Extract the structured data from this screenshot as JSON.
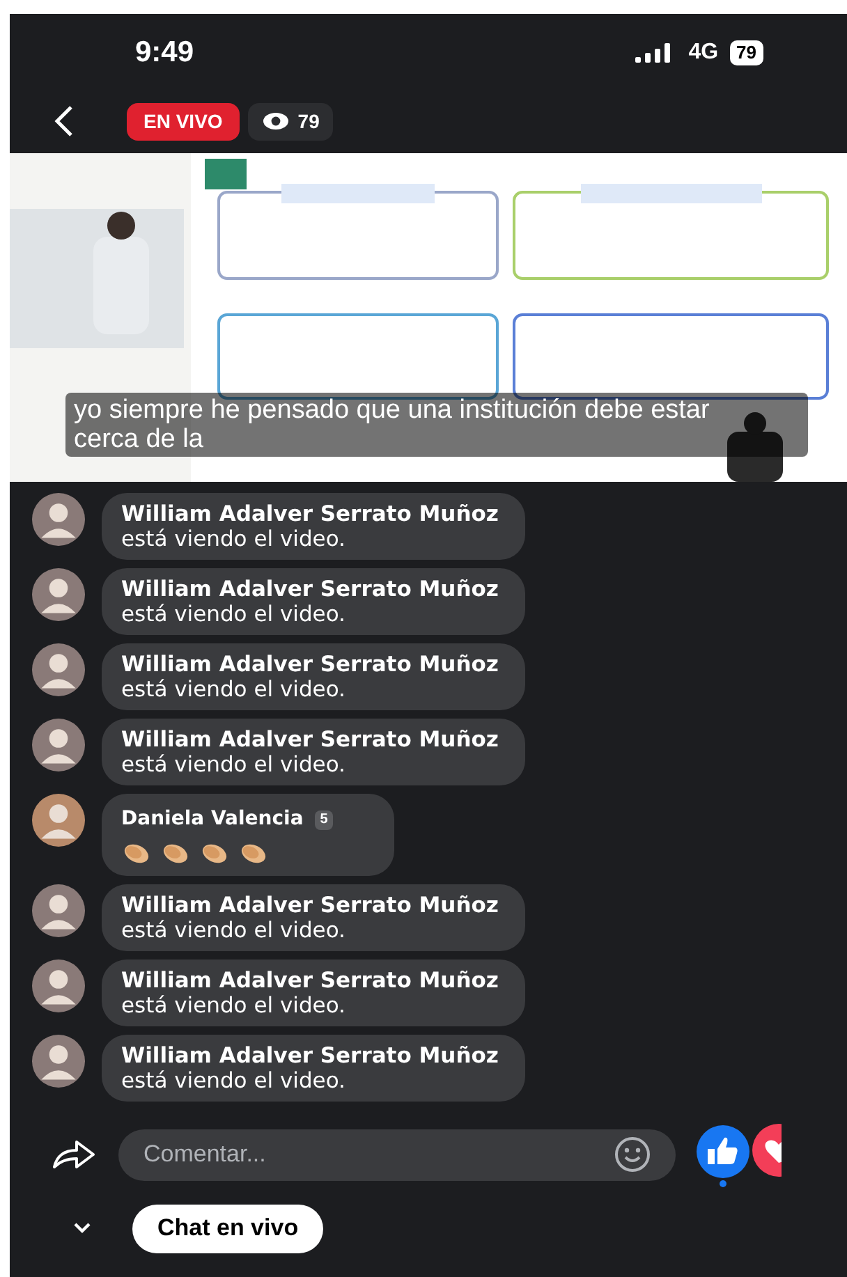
{
  "status_bar": {
    "time": "9:49",
    "network": "4G",
    "battery": "79"
  },
  "header": {
    "live_label": "EN VIVO",
    "viewers": "79"
  },
  "video": {
    "kind": "picture",
    "caption": "yo siempre he pensado que una institución debe estar cerca de la"
  },
  "chat": [
    {
      "kind": "join",
      "name": "William Adalver Serrato Muñoz",
      "text": "está viendo el video."
    },
    {
      "kind": "join",
      "name": "William Adalver Serrato Muñoz",
      "text": "está viendo el video."
    },
    {
      "kind": "join",
      "name": "William Adalver Serrato Muñoz",
      "text": "está viendo el video."
    },
    {
      "kind": "join",
      "name": "William Adalver Serrato Muñoz",
      "text": "está viendo el video."
    },
    {
      "kind": "comment",
      "name": "Daniela Valencia",
      "badge": "5",
      "reactions": [
        {
          "kind": "clap"
        },
        {
          "kind": "clap"
        },
        {
          "kind": "clap"
        },
        {
          "kind": "clap"
        }
      ]
    },
    {
      "kind": "join",
      "name": "William Adalver Serrato Muñoz",
      "text": "está viendo el video."
    },
    {
      "kind": "join",
      "name": "William Adalver Serrato Muñoz",
      "text": "está viendo el video."
    },
    {
      "kind": "join",
      "name": "William Adalver Serrato Muñoz",
      "text": "está viendo el video."
    }
  ],
  "composer": {
    "placeholder": "Comentar..."
  },
  "chat_toggle": {
    "label": "Chat en vivo"
  }
}
